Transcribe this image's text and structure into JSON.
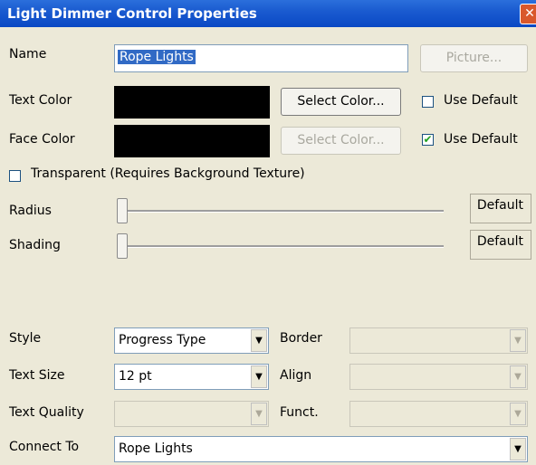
{
  "window": {
    "title": "Light Dimmer Control Properties",
    "close_symbol": "✕"
  },
  "name": {
    "label": "Name",
    "value": "Rope Lights",
    "picture_button": "Picture..."
  },
  "text_color": {
    "label": "Text Color",
    "swatch_color": "#000000",
    "select_button": "Select Color...",
    "use_default_label": "Use Default",
    "use_default_checked": false
  },
  "face_color": {
    "label": "Face Color",
    "swatch_color": "#000000",
    "select_button": "Select Color...",
    "use_default_label": "Use Default",
    "use_default_checked": true
  },
  "transparent": {
    "label": "Transparent (Requires Background Texture)",
    "checked": false
  },
  "radius": {
    "label": "Radius",
    "value_label": "Default",
    "level": 0
  },
  "shading": {
    "label": "Shading",
    "value_label": "Default",
    "level": 0
  },
  "style": {
    "label": "Style",
    "value": "Progress Type"
  },
  "border": {
    "label": "Border",
    "value": ""
  },
  "text_size": {
    "label": "Text Size",
    "value": "12 pt"
  },
  "align": {
    "label": "Align",
    "value": ""
  },
  "text_quality": {
    "label": "Text Quality",
    "value": ""
  },
  "funct": {
    "label": "Funct.",
    "value": ""
  },
  "connect_to": {
    "label": "Connect To",
    "value": "Rope Lights"
  },
  "glyphs": {
    "dropdown": "▼",
    "check": "✔"
  }
}
